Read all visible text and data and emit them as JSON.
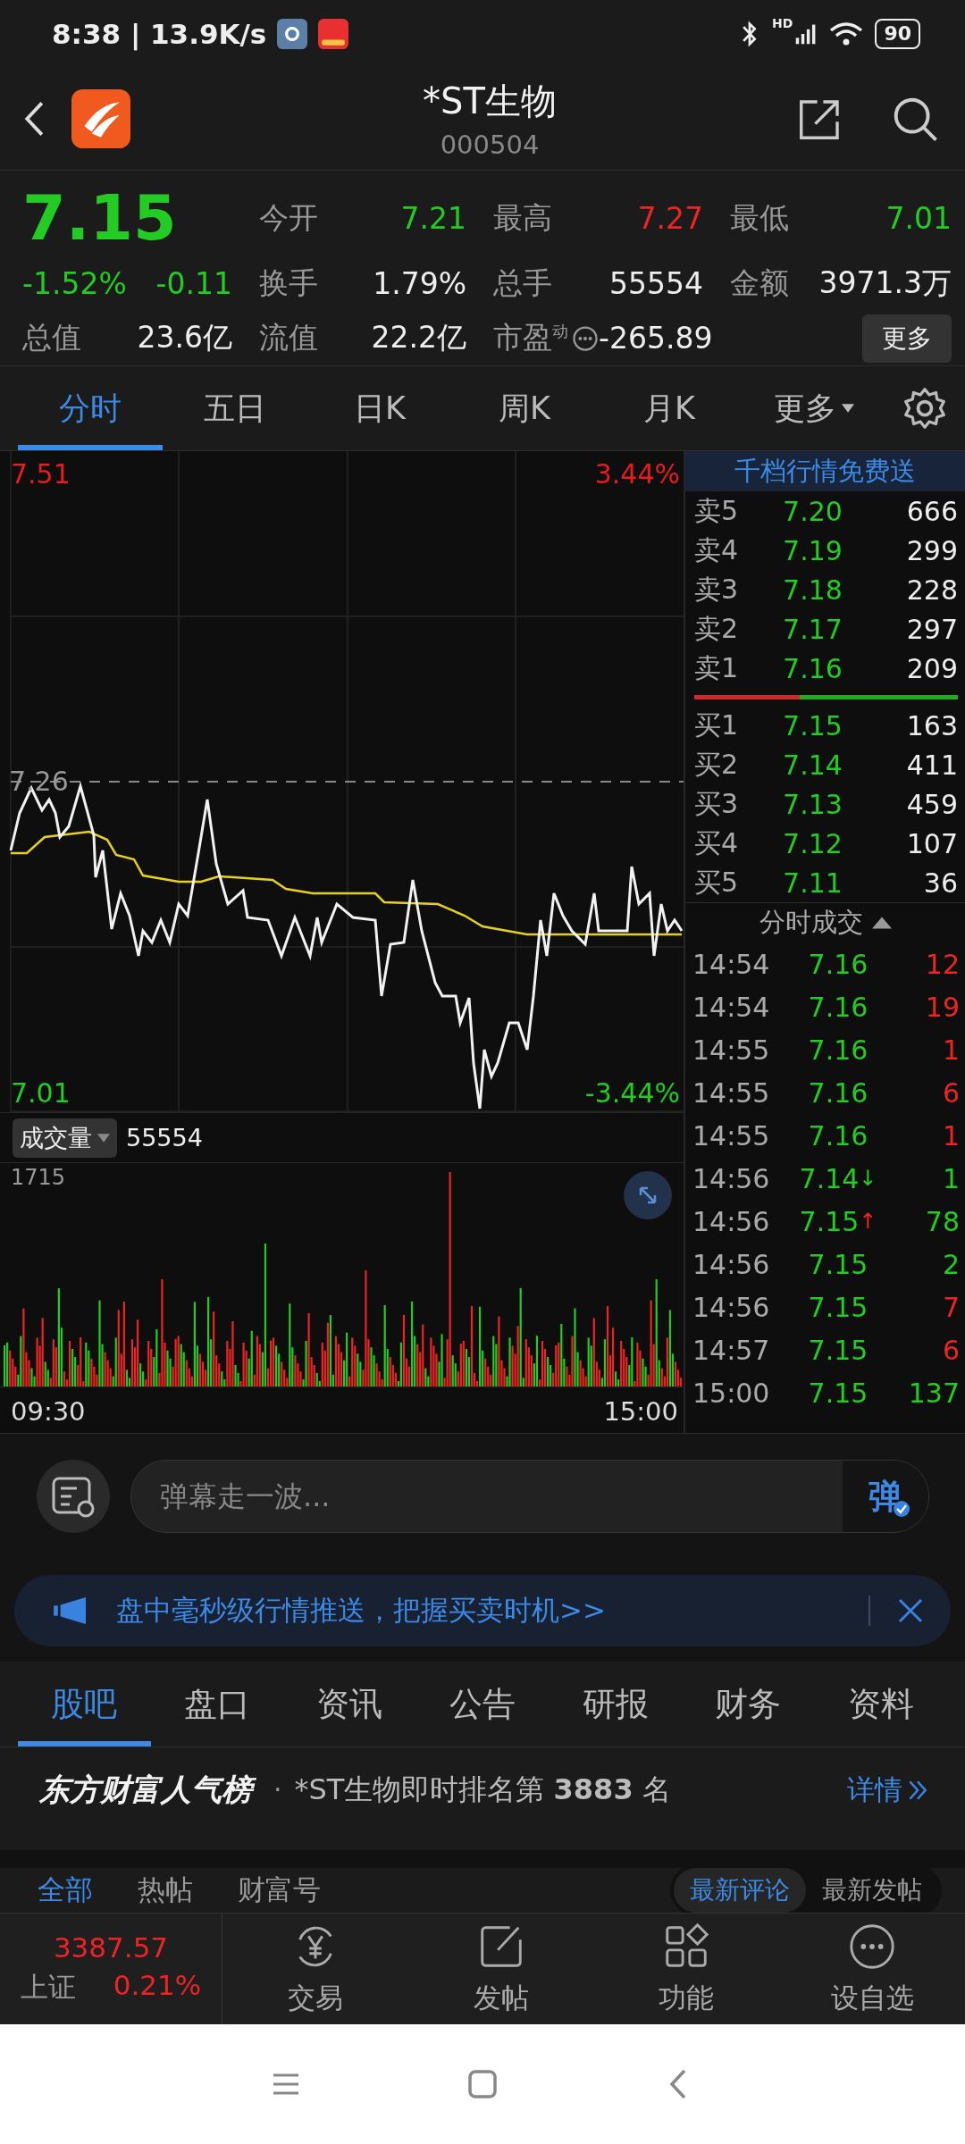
{
  "status_bar": {
    "time": "8:38 | 13.9K/s",
    "network": "HD",
    "battery": "90"
  },
  "header": {
    "title": "*ST生物",
    "code": "000504"
  },
  "quote": {
    "price": "7.15",
    "change_pct": "-1.52%",
    "change": "-0.11",
    "color": "#22cc22",
    "stats": [
      {
        "label": "今开",
        "value": "7.21",
        "color": "#22cc22"
      },
      {
        "label": "最高",
        "value": "7.27",
        "color": "#ee2424"
      },
      {
        "label": "最低",
        "value": "7.01",
        "color": "#22cc22"
      },
      {
        "label": "换手",
        "value": "1.79%",
        "color": "#eeeeee"
      },
      {
        "label": "总手",
        "value": "55554",
        "color": "#eeeeee"
      },
      {
        "label": "金额",
        "value": "3971.3万",
        "color": "#eeeeee"
      },
      {
        "label": "总值",
        "value": "23.6亿",
        "color": "#eeeeee"
      },
      {
        "label": "流值",
        "value": "22.2亿",
        "color": "#eeeeee"
      },
      {
        "label": "市盈$^{动}$",
        "value": "-265.89",
        "color": "#eeeeee",
        "kind": "pe"
      }
    ],
    "more_button": "更多"
  },
  "tabs": [
    {
      "label": "分时",
      "selected": true
    },
    {
      "label": "五日",
      "selected": false
    },
    {
      "label": "日K",
      "selected": false
    },
    {
      "label": "周K",
      "selected": false
    },
    {
      "label": "月K",
      "selected": false
    },
    {
      "label": "更多",
      "selected": false,
      "dropdown": true
    }
  ],
  "chart": {
    "high_price": "7.51",
    "high_pct": "3.44%",
    "prev_close": "7.26",
    "low_price": "7.01",
    "low_pct": "-3.44%",
    "volume_label": "成交量",
    "volume": "55554",
    "volume_max": "1715",
    "time_start": "09:30",
    "time_end": "15:00"
  },
  "order_book": {
    "promo": "千档行情免费送",
    "asks": [
      {
        "label": "卖5",
        "price": "7.20",
        "volume": "666",
        "color": "#22cc22"
      },
      {
        "label": "卖4",
        "price": "7.19",
        "volume": "299",
        "color": "#22cc22"
      },
      {
        "label": "卖3",
        "price": "7.18",
        "volume": "228",
        "color": "#22cc22"
      },
      {
        "label": "卖2",
        "price": "7.17",
        "volume": "297",
        "color": "#22cc22"
      },
      {
        "label": "卖1",
        "price": "7.16",
        "volume": "209",
        "color": "#22cc22"
      }
    ],
    "ratio": {
      "level": 0.4
    },
    "bids": [
      {
        "label": "买1",
        "price": "7.15",
        "volume": "163",
        "color": "#22cc22"
      },
      {
        "label": "买2",
        "price": "7.14",
        "volume": "411",
        "color": "#22cc22"
      },
      {
        "label": "买3",
        "price": "7.13",
        "volume": "459",
        "color": "#22cc22"
      },
      {
        "label": "买4",
        "price": "7.12",
        "volume": "107",
        "color": "#22cc22"
      },
      {
        "label": "买5",
        "price": "7.11",
        "volume": "36",
        "color": "#22cc22"
      }
    ]
  },
  "trades": {
    "title": "分时成交",
    "rows": [
      {
        "time": "14:54",
        "price": "7.16",
        "volume": "12",
        "color": "#ee2424"
      },
      {
        "time": "14:54",
        "price": "7.16",
        "volume": "19",
        "color": "#ee2424"
      },
      {
        "time": "14:55",
        "price": "7.16",
        "volume": "1",
        "color": "#ee2424"
      },
      {
        "time": "14:55",
        "price": "7.16",
        "volume": "6",
        "color": "#ee2424"
      },
      {
        "time": "14:55",
        "price": "7.16",
        "volume": "1",
        "color": "#ee2424"
      },
      {
        "time": "14:56",
        "price": "7.14",
        "volume": "1",
        "color": "#22cc22",
        "arrow": {
          "text": "↓",
          "color": "#22cc22"
        }
      },
      {
        "time": "14:56",
        "price": "7.15",
        "volume": "78",
        "color": "#22cc22",
        "arrow": {
          "text": "↑",
          "color": "#ee2424"
        }
      },
      {
        "time": "14:56",
        "price": "7.15",
        "volume": "2",
        "color": "#22cc22"
      },
      {
        "time": "14:56",
        "price": "7.15",
        "volume": "7",
        "color": "#ee2424"
      },
      {
        "time": "14:57",
        "price": "7.15",
        "volume": "6",
        "color": "#ee2424"
      },
      {
        "time": "15:00",
        "price": "7.15",
        "volume": "137",
        "color": "#22cc22"
      }
    ]
  },
  "danmaku": {
    "placeholder": "弹幕走一波...",
    "send": "弹"
  },
  "banner": {
    "text": "盘中毫秒级行情推送，把握买卖时机>>"
  },
  "section_tabs": [
    {
      "label": "股吧",
      "selected": true
    },
    {
      "label": "盘口",
      "selected": false
    },
    {
      "label": "资讯",
      "selected": false
    },
    {
      "label": "公告",
      "selected": false
    },
    {
      "label": "研报",
      "selected": false
    },
    {
      "label": "财务",
      "selected": false
    },
    {
      "label": "资料",
      "selected": false
    }
  ],
  "ranking": {
    "brand": "东方财富人气榜",
    "separator": "·",
    "text": "*ST生物即时排名第 **3883** 名",
    "link": "详情"
  },
  "post_tabs": [
    {
      "label": "全部",
      "selected": true
    },
    {
      "label": "热帖",
      "selected": false
    },
    {
      "label": "财富号",
      "selected": false
    }
  ],
  "sort_options": [
    {
      "label": "最新评论",
      "selected": true
    },
    {
      "label": "最新发帖",
      "selected": false
    }
  ],
  "bottom_bar": {
    "index": {
      "value": "3387.57",
      "name": "上证",
      "change": "0.21%",
      "color": "#ee2424"
    },
    "items": [
      {
        "label": "交易",
        "kind": "trade"
      },
      {
        "label": "发帖",
        "kind": "post"
      },
      {
        "label": "功能",
        "kind": "tools"
      },
      {
        "label": "设自选",
        "kind": "watch"
      }
    ]
  }
}
